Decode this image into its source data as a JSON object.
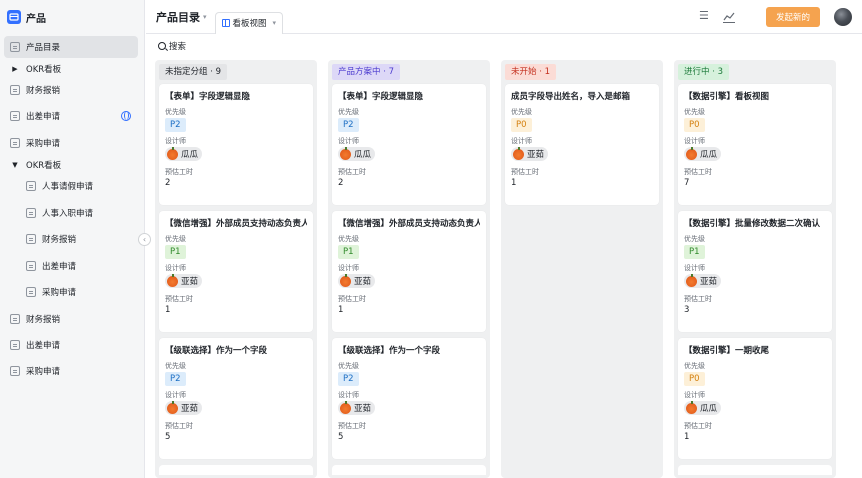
{
  "app": {
    "title": "产品"
  },
  "sidebar": {
    "items": [
      {
        "label": "产品目录"
      },
      {
        "label": "OKR看板"
      },
      {
        "label": "财务报销"
      },
      {
        "label": "出差申请"
      },
      {
        "label": "采购申请"
      },
      {
        "label": "OKR看板"
      },
      {
        "label": "人事请假申请"
      },
      {
        "label": "人事入职申请"
      },
      {
        "label": "财务报销"
      },
      {
        "label": "出差申请"
      },
      {
        "label": "采购申请"
      },
      {
        "label": "财务报销"
      },
      {
        "label": "出差申请"
      },
      {
        "label": "采购申请"
      }
    ]
  },
  "header": {
    "title": "产品目录",
    "view_tab": "看板视图",
    "new_button": "发起新的"
  },
  "search": {
    "label": "搜索"
  },
  "fields": {
    "priority": "优先级",
    "designer": "设计师",
    "estimate": "预估工时"
  },
  "colors": {
    "accent": "#3370ff",
    "new_button": "#f5a34f"
  },
  "columns": [
    {
      "label": "未指定分组 · 9",
      "tag_bg": "#e4e5e7",
      "tag_fg": "#1f2329",
      "cards": [
        {
          "title": "【表单】字段逻辑显隐",
          "priority": "P2",
          "designer": "瓜瓜",
          "estimate": "2"
        },
        {
          "title": "【微信增强】外部成员支持动态负责人",
          "priority": "P1",
          "designer": "亚茹",
          "estimate": "1"
        },
        {
          "title": "【级联选择】作为一个字段",
          "priority": "P2",
          "designer": "亚茹",
          "estimate": "5"
        }
      ]
    },
    {
      "label": "产品方案中 · 7",
      "tag_bg": "#ddd8f7",
      "tag_fg": "#4d3ccf",
      "cards": [
        {
          "title": "【表单】字段逻辑显隐",
          "priority": "P2",
          "designer": "瓜瓜",
          "estimate": "2"
        },
        {
          "title": "【微信增强】外部成员支持动态负责人",
          "priority": "P1",
          "designer": "亚茹",
          "estimate": "1"
        },
        {
          "title": "【级联选择】作为一个字段",
          "priority": "P2",
          "designer": "亚茹",
          "estimate": "5"
        }
      ]
    },
    {
      "label": "未开始 · 1",
      "tag_bg": "#fbdcd6",
      "tag_fg": "#c4301f",
      "cards": [
        {
          "title": "成员字段导出姓名，导入是邮箱",
          "priority": "P0",
          "designer": "亚茹",
          "estimate": "1"
        }
      ]
    },
    {
      "label": "进行中 · 3",
      "tag_bg": "#d6f1dc",
      "tag_fg": "#1d7a3a",
      "cards": [
        {
          "title": "【数据引擎】看板视图",
          "priority": "P0",
          "designer": "瓜瓜",
          "estimate": "7"
        },
        {
          "title": "【数据引擎】批量修改数据二次确认",
          "priority": "P1",
          "designer": "亚茹",
          "estimate": "3"
        },
        {
          "title": "【数据引擎】一期收尾",
          "priority": "P0",
          "designer": "瓜瓜",
          "estimate": "1"
        }
      ]
    }
  ]
}
